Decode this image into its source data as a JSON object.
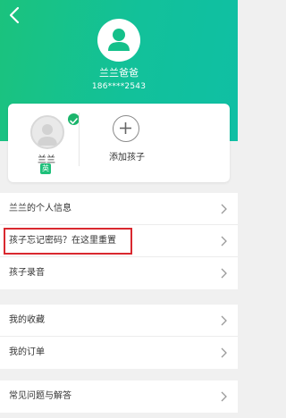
{
  "header": {
    "back_icon": "chevron-left-icon",
    "avatar_icon": "user-avatar-icon",
    "parent_name": "兰兰爸爸",
    "parent_phone": "186****2543",
    "colors": {
      "gradient_start": "#1bc27d",
      "gradient_end": "#0fbfa4"
    }
  },
  "children": {
    "items": [
      {
        "name": "兰兰",
        "tag": "英",
        "selected": true
      }
    ],
    "add_label": "添加孩子"
  },
  "menu": {
    "group1": [
      {
        "label": "兰兰的个人信息"
      },
      {
        "label": "孩子忘记密码？在这里重置",
        "highlighted": true
      },
      {
        "label": "孩子录音"
      }
    ],
    "group2": [
      {
        "label": "我的收藏"
      },
      {
        "label": "我的订单"
      }
    ],
    "group3": [
      {
        "label": "常见问题与解答"
      }
    ]
  },
  "annotation": {
    "highlight_color": "#d9282f"
  }
}
